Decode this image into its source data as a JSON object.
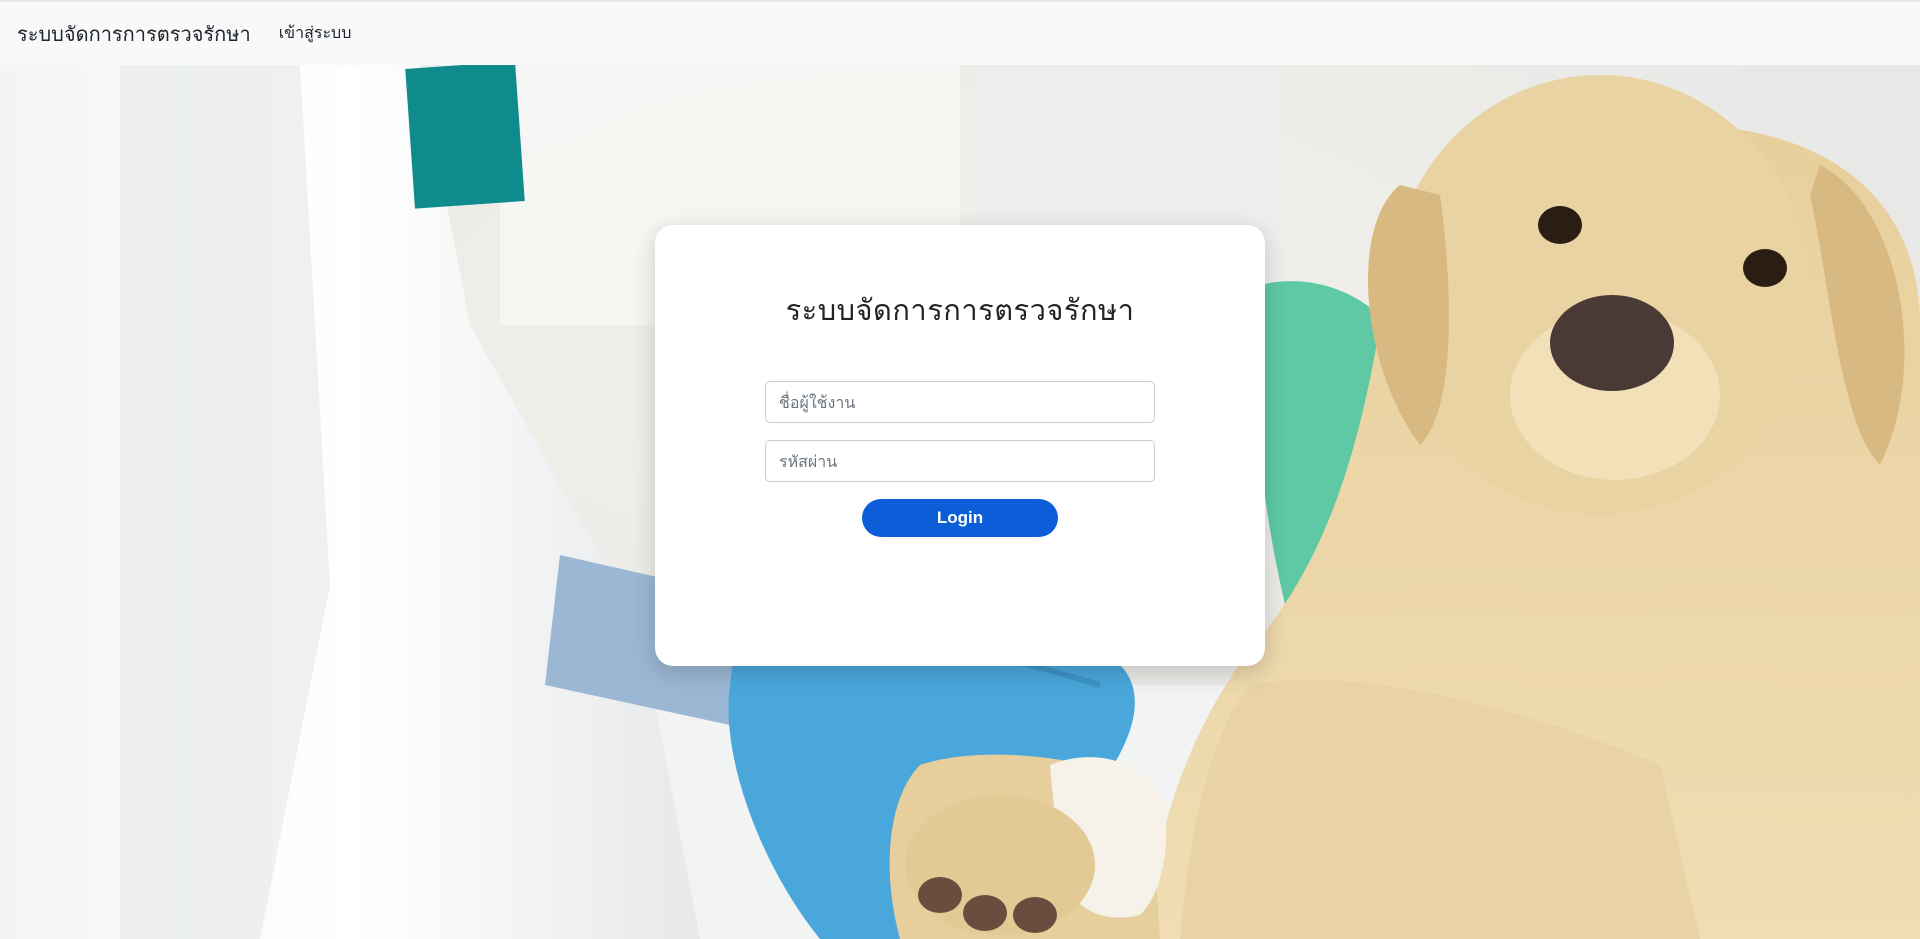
{
  "navbar": {
    "brand": "ระบบจัดการการตรวจรักษา",
    "login_link": "เข้าสู่ระบบ"
  },
  "login_card": {
    "title": "ระบบจัดการการตรวจรักษา",
    "username_placeholder": "ชื่อผู้ใช้งาน",
    "password_placeholder": "รหัสผ่าน",
    "button_label": "Login"
  },
  "colors": {
    "navbar_bg": "#f8f9fa",
    "primary_button": "#0b5ed7",
    "card_bg": "#ffffff"
  }
}
